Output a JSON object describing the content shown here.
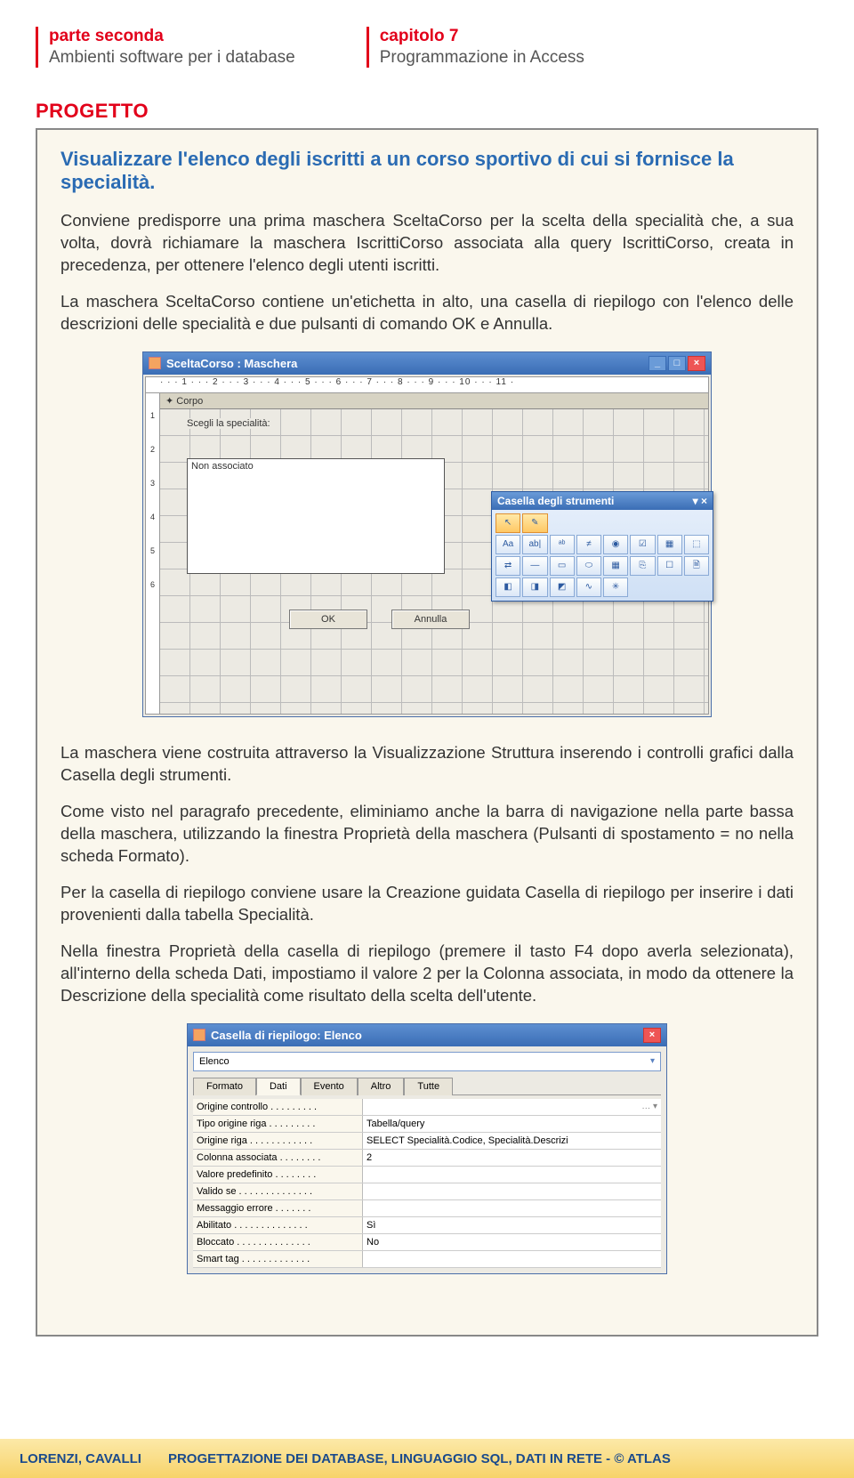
{
  "header": {
    "left": {
      "part": "parte seconda",
      "sub": "Ambienti software per i database"
    },
    "right": {
      "part": "capitolo 7",
      "sub": "Programmazione in Access"
    }
  },
  "project_label": "PROGETTO",
  "intro_heading": "Visualizzare l'elenco degli iscritti a un corso sportivo di cui si fornisce la specialità.",
  "para1": "Conviene predisporre una prima maschera SceltaCorso per la scelta della specialità che, a sua volta, dovrà richiamare la maschera IscrittiCorso associata alla query IscrittiCorso, creata in precedenza, per ottenere l'elenco degli utenti iscritti.",
  "para2": "La maschera SceltaCorso contiene un'etichetta in alto, una casella di riepilogo con l'elenco delle descrizioni delle specialità e due pulsanti di comando OK e Annulla.",
  "para3": "La maschera viene costruita attraverso la Visualizzazione Struttura inserendo i controlli grafici dalla Casella degli strumenti.",
  "para4": "Come visto nel paragrafo precedente, eliminiamo anche la barra di navigazione nella parte bassa della maschera, utilizzando la finestra Proprietà della maschera (Pulsanti di spostamento = no nella scheda Formato).",
  "para5": "Per la casella di riepilogo conviene usare la Creazione guidata Casella di riepilogo per inserire i dati provenienti dalla tabella Specialità.",
  "para6": "Nella finestra Proprietà della casella di riepilogo (premere il tasto F4 dopo averla selezionata), all'interno della scheda Dati, impostiamo il valore 2 per la Colonna associata, in modo da ottenere la Descrizione della specialità come risultato della scelta dell'utente.",
  "ss1": {
    "title": "SceltaCorso : Maschera",
    "ruler_h": "· · · 1 · · · 2 · · · 3 · · · 4 · · · 5 · · · 6 · · · 7 · · · 8 · · · 9 · · · 10 · · · 11 ·",
    "ruler_v": [
      "1",
      "2",
      "3",
      "4",
      "5",
      "6"
    ],
    "section": "✦ Corpo",
    "label_scegli": "Scegli la specialità:",
    "listbox_value": "Non associato",
    "btn_ok": "OK",
    "btn_annulla": "Annulla",
    "toolbox_title": "Casella degli strumenti",
    "toolbox_items": [
      "↖",
      "✎",
      "Aa",
      "ab|",
      "ᵃᵇ",
      "≠",
      "◉",
      "☑",
      "▦",
      "⬚",
      "⇄",
      "—",
      "▭",
      "⬭",
      "▦",
      "⎘",
      "☐",
      "🗎",
      "◧",
      "◨",
      "◩",
      "∿",
      "✳"
    ]
  },
  "ss2": {
    "title": "Casella di riepilogo: Elenco",
    "dropdown": "Elenco",
    "tabs": [
      "Formato",
      "Dati",
      "Evento",
      "Altro",
      "Tutte"
    ],
    "active_tab": 1,
    "props": [
      {
        "label": "Origine controllo",
        "value": "",
        "extra": "… ▾"
      },
      {
        "label": "Tipo origine riga",
        "value": "Tabella/query"
      },
      {
        "label": "Origine riga",
        "value": "SELECT Specialità.Codice, Specialità.Descrizi"
      },
      {
        "label": "Colonna associata",
        "value": "2"
      },
      {
        "label": "Valore predefinito",
        "value": ""
      },
      {
        "label": "Valido se",
        "value": ""
      },
      {
        "label": "Messaggio errore",
        "value": ""
      },
      {
        "label": "Abilitato",
        "value": "Sì"
      },
      {
        "label": "Bloccato",
        "value": "No"
      },
      {
        "label": "Smart tag",
        "value": ""
      }
    ]
  },
  "footer": {
    "authors": "LORENZI, CAVALLI",
    "book": "PROGETTAZIONE DEI DATABASE, LINGUAGGIO SQL, DATI IN RETE - © ATLAS"
  }
}
